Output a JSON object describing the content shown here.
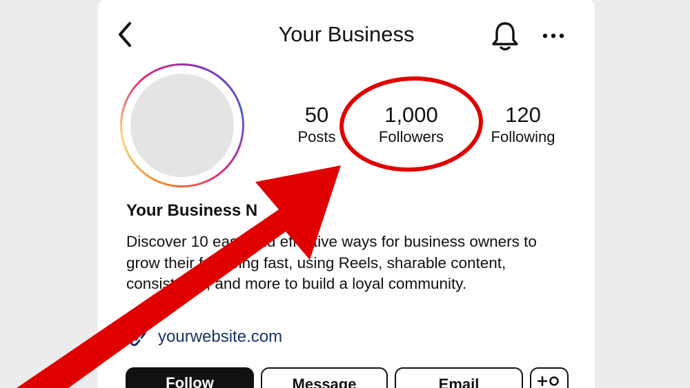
{
  "header": {
    "title": "Your Business",
    "back_icon": "chevron-left-icon",
    "bell_icon": "bell-icon",
    "more_icon": "more-horizontal-icon"
  },
  "profile": {
    "stats": [
      {
        "value": "50",
        "label": "Posts"
      },
      {
        "value": "1,000",
        "label": "Followers"
      },
      {
        "value": "120",
        "label": "Following"
      }
    ],
    "name": "Your Business N",
    "bio": [
      "Discover 10 easy and effective ways for business owners to",
      "grow their following fast, using Reels, sharable content,",
      "consistency, and more to build a loyal community."
    ],
    "link_icon": "link-icon",
    "website": "yourwebsite.com"
  },
  "actions": {
    "follow": "Follow",
    "message": "Message",
    "email": "Email",
    "add_user_icon": "add-user-icon"
  },
  "annotation": {
    "highlight_color": "#e00000",
    "circled_item": "Followers"
  }
}
